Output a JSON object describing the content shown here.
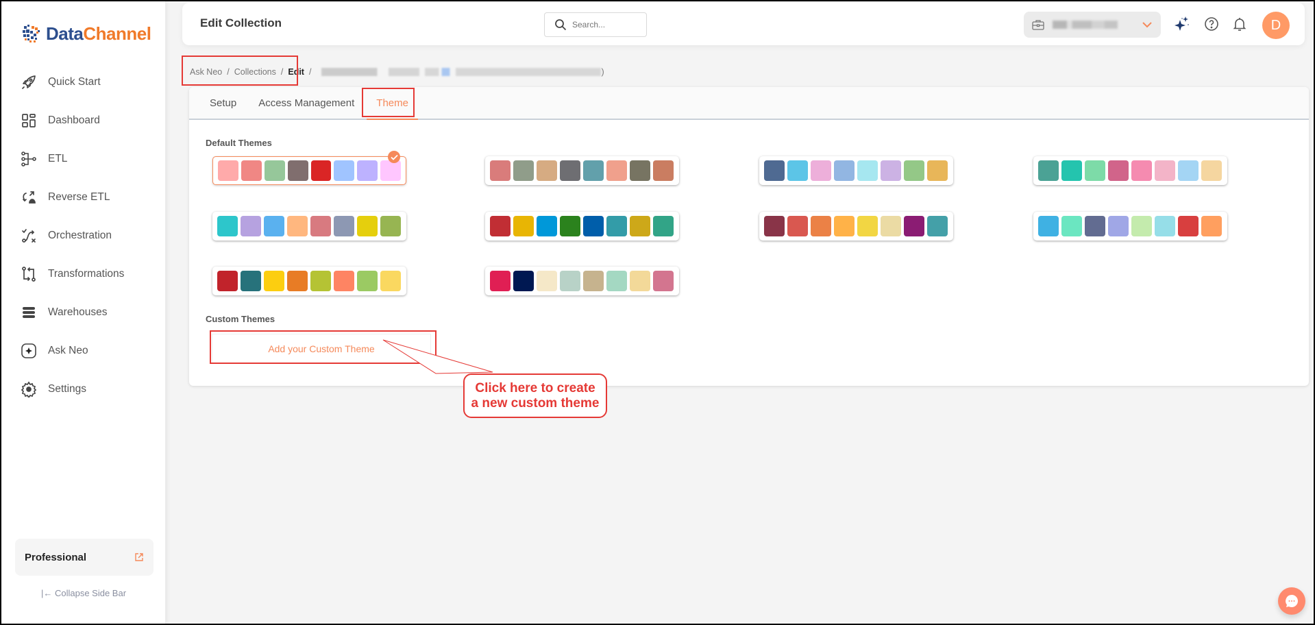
{
  "app": {
    "logo_part1": "Data",
    "logo_part2": "Channel"
  },
  "sidebar": {
    "items": [
      {
        "label": "Quick Start",
        "icon": "rocket-icon"
      },
      {
        "label": "Dashboard",
        "icon": "dashboard-icon"
      },
      {
        "label": "ETL",
        "icon": "etl-icon"
      },
      {
        "label": "Reverse ETL",
        "icon": "reverse-etl-icon"
      },
      {
        "label": "Orchestration",
        "icon": "orchestration-icon"
      },
      {
        "label": "Transformations",
        "icon": "transformations-icon"
      },
      {
        "label": "Warehouses",
        "icon": "warehouses-icon"
      },
      {
        "label": "Ask Neo",
        "icon": "ask-neo-icon"
      },
      {
        "label": "Settings",
        "icon": "gear-icon"
      }
    ],
    "plan_label": "Professional",
    "collapse_label": "Collapse Side Bar",
    "collapse_glyph": "|←"
  },
  "header": {
    "title": "Edit Collection",
    "search_placeholder": "Search...",
    "avatar_initial": "D"
  },
  "breadcrumb": {
    "items": [
      "Ask Neo",
      "Collections",
      "Edit"
    ],
    "separator": "/",
    "tail": ")"
  },
  "tabs": [
    {
      "label": "Setup",
      "active": false
    },
    {
      "label": "Access Management",
      "active": false
    },
    {
      "label": "Theme",
      "active": true
    }
  ],
  "theme": {
    "default_label": "Default Themes",
    "custom_label": "Custom Themes",
    "add_custom_label": "Add your Custom Theme",
    "selected_index": 0,
    "palettes": [
      [
        "#FFAAAA",
        "#F08784",
        "#96C79A",
        "#806E6E",
        "#DA2525",
        "#A0C4FF",
        "#BDB2FF",
        "#FFC6FF"
      ],
      [
        "#D97C7B",
        "#909D8A",
        "#D6AB82",
        "#6E6E72",
        "#62A0AB",
        "#F0A08C",
        "#777462",
        "#CA7D61"
      ],
      [
        "#4F6A92",
        "#5CC5E7",
        "#EDAFDA",
        "#92B6E2",
        "#A6E7F0",
        "#CCB2E4",
        "#94C887",
        "#E8B659"
      ],
      [
        "#4BA295",
        "#24C4AE",
        "#7DDBA8",
        "#D1648A",
        "#F58BB0",
        "#F3B4C8",
        "#A4D5F4",
        "#F5D6A0"
      ],
      [
        "#2DC6CB",
        "#B6A2E0",
        "#5AB1EF",
        "#FFB77F",
        "#D87A80",
        "#8D98B3",
        "#E5CF0D",
        "#97B552"
      ],
      [
        "#C12E34",
        "#E8B504",
        "#0098D9",
        "#2B821D",
        "#005EAA",
        "#339CA8",
        "#CDA819",
        "#32A487"
      ],
      [
        "#893448",
        "#D95850",
        "#EB8146",
        "#FFB248",
        "#F2D643",
        "#EBDBA4",
        "#8B1C73",
        "#44A0A8"
      ],
      [
        "#3FB1E3",
        "#6BE6C1",
        "#626C91",
        "#A0A7E6",
        "#C4EBAD",
        "#96DEE8",
        "#D83F3F",
        "#FF9F5F"
      ],
      [
        "#C1232B",
        "#27727B",
        "#FCCE10",
        "#E87C25",
        "#B5C334",
        "#FE8463",
        "#9BCA63",
        "#FAD860"
      ],
      [
        "#E01F54",
        "#001852",
        "#F5E8C8",
        "#B8D2C7",
        "#C6B38E",
        "#A4D8C2",
        "#F3D999",
        "#D3758F"
      ]
    ]
  },
  "annotation": {
    "callout_line1": "Click here to create",
    "callout_line2": "a new custom theme",
    "color": "#E53935"
  },
  "colors": {
    "accent": "#F5895A",
    "avatar": "#FF9A66",
    "logo_blue": "#2D4F8E",
    "logo_orange": "#F07A2A"
  }
}
